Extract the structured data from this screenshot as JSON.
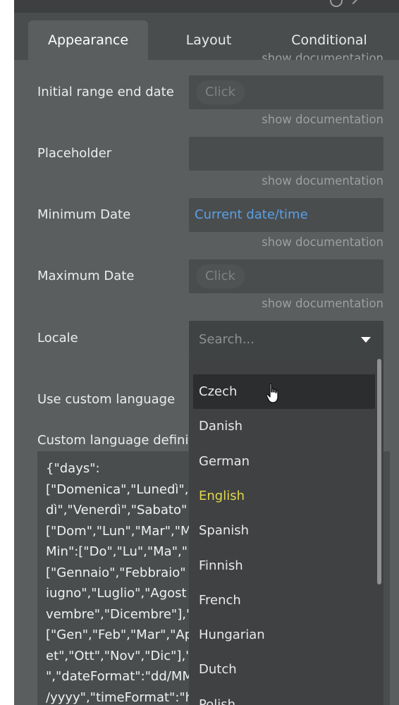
{
  "tabs": [
    {
      "label": "Appearance",
      "active": true
    },
    {
      "label": "Layout",
      "active": false
    },
    {
      "label": "Conditional",
      "active": false
    }
  ],
  "doc_link": "show documentation",
  "fields": {
    "initial_range_end": {
      "label": "Initial range end date",
      "chip": "Click"
    },
    "placeholder": {
      "label": "Placeholder",
      "value": ""
    },
    "minimum_date": {
      "label": "Minimum Date",
      "value": "Current date/time"
    },
    "maximum_date": {
      "label": "Maximum Date",
      "chip": "Click"
    },
    "locale": {
      "label": "Locale",
      "search_placeholder": "Search..."
    },
    "use_custom_language": {
      "label": "Use custom language"
    },
    "custom_language_definition": {
      "label": "Custom language defini",
      "lines": [
        "{\"days\":",
        "[\"Domenica\",\"Lunedì\",",
        "dì\",\"Venerdì\",\"Sabato\"",
        "[\"Dom\",\"Lun\",\"Mar\",\"M",
        "Min\":[\"Do\",\"Lu\",\"Ma\",\"",
        "[\"Gennaio\",\"Febbraio\"",
        "iugno\",\"Luglio\",\"Agost",
        "vembre\",\"Dicembre\"],\"",
        "[\"Gen\",\"Feb\",\"Mar\",\"Ap",
        "et\",\"Ott\",\"Nov\",\"Dic\"],\"",
        "\",\"dateFormat\":\"dd/MM",
        "/yyyy\",\"timeFormat\":\"h"
      ]
    }
  },
  "locale_options": [
    {
      "label": "Czech",
      "state": "hover"
    },
    {
      "label": "Danish",
      "state": ""
    },
    {
      "label": "German",
      "state": ""
    },
    {
      "label": "English",
      "state": "selected"
    },
    {
      "label": "Spanish",
      "state": ""
    },
    {
      "label": "Finnish",
      "state": ""
    },
    {
      "label": "French",
      "state": ""
    },
    {
      "label": "Hungarian",
      "state": ""
    },
    {
      "label": "Dutch",
      "state": ""
    },
    {
      "label": "Polish",
      "state": ""
    }
  ],
  "colors": {
    "panel_bg": "#5b5e5f",
    "field_bg": "#4a4d4e",
    "link_blue": "#5aa0e6",
    "selected_yellow": "#e2d84d"
  }
}
